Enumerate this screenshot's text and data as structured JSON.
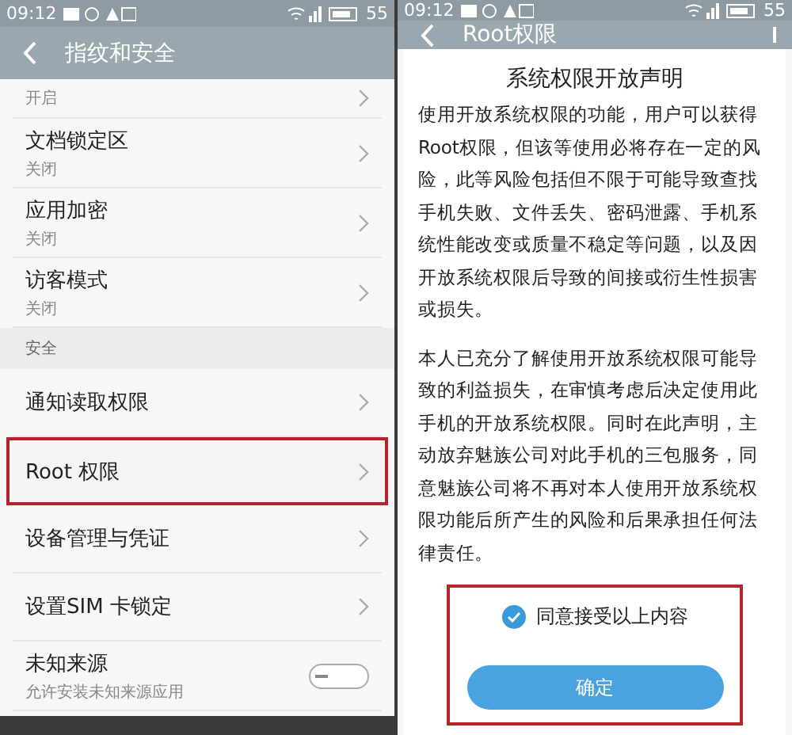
{
  "left": {
    "status_bar": {
      "time": "09:12",
      "battery": "55"
    },
    "header": {
      "title": "指纹和安全"
    },
    "items": [
      {
        "kind": "nav",
        "subtitle": "开启",
        "highlighted": false
      },
      {
        "kind": "nav",
        "title": "文档锁定区",
        "subtitle": "关闭",
        "highlighted": false
      },
      {
        "kind": "nav",
        "title": "应用加密",
        "subtitle": "关闭",
        "highlighted": false
      },
      {
        "kind": "nav",
        "title": "访客模式",
        "subtitle": "关闭",
        "highlighted": false
      },
      {
        "kind": "section",
        "title": "安全"
      },
      {
        "kind": "nav",
        "title": "通知读取权限",
        "highlighted": false
      },
      {
        "kind": "nav",
        "title": "Root 权限",
        "highlighted": true
      },
      {
        "kind": "nav",
        "title": "设备管理与凭证",
        "highlighted": false
      },
      {
        "kind": "nav",
        "title": "设置SIM 卡锁定",
        "highlighted": false
      },
      {
        "kind": "toggle",
        "title": "未知来源",
        "subtitle": "允许安装未知来源应用",
        "on": false,
        "highlighted": false
      }
    ]
  },
  "right": {
    "status_bar": {
      "time": "09:12",
      "battery": "55"
    },
    "header": {
      "title": "Root权限"
    },
    "dialog": {
      "title": "系统权限开放声明",
      "paragraphs": [
        "使用开放系统权限的功能，用户可以获得Root权限，但该等使用必将存在一定的风险，此等风险包括但不限于可能导致查找手机失败、文件丢失、密码泄露、手机系统性能改变或质量不稳定等问题，以及因开放系统权限后导致的间接或衍生性损害或损失。",
        "本人已充分了解使用开放系统权限可能导致的利益损失，在审慎考虑后决定使用此手机的开放系统权限。同时在此声明，主动放弃魅族公司对此手机的三包服务，同意魅族公司将不再对本人使用开放系统权限功能后所产生的风险和后果承担任何法律责任。"
      ],
      "agree": {
        "label": "同意接受以上内容",
        "checked": true
      },
      "confirm": "确定",
      "highlighted": true
    }
  }
}
